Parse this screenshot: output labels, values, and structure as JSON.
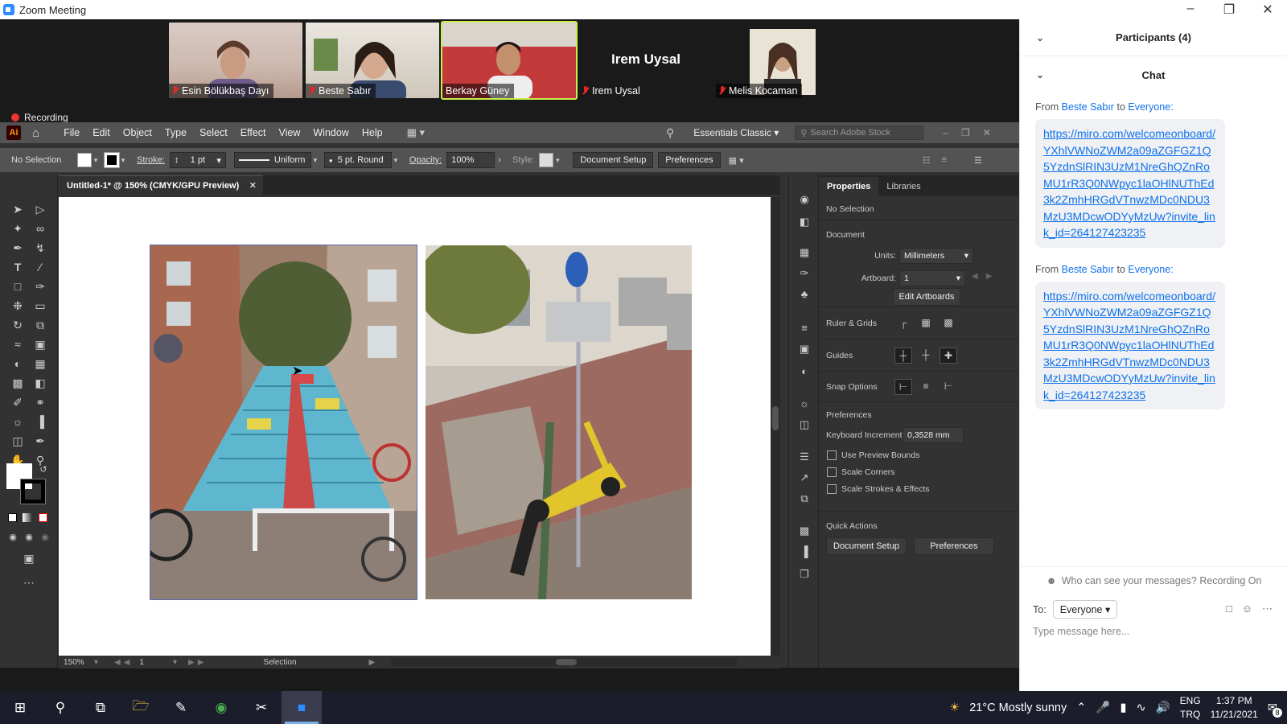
{
  "window": {
    "title": "Zoom Meeting"
  },
  "participants": [
    {
      "name": "Esin Bölükbaş Dayı",
      "muted": true
    },
    {
      "name": "Beste Sabır",
      "muted": true
    },
    {
      "name": "Berkay Güney",
      "muted": false
    },
    {
      "name": "Irem Uysal",
      "muted": true,
      "center_name": "Irem Uysal"
    },
    {
      "name": "Melis Kocaman",
      "muted": true
    }
  ],
  "recording_label": "Recording",
  "illustrator": {
    "menu": [
      "File",
      "Edit",
      "Object",
      "Type",
      "Select",
      "Effect",
      "View",
      "Window",
      "Help"
    ],
    "workspace": "Essentials Classic",
    "search_placeholder": "Search Adobe Stock",
    "control": {
      "selection": "No Selection",
      "stroke_label": "Stroke:",
      "stroke_value": "1 pt",
      "stroke_profile": "Uniform",
      "brush": "5 pt. Round",
      "opacity_label": "Opacity:",
      "opacity_value": "100%",
      "style_label": "Style:",
      "document_setup": "Document Setup",
      "preferences": "Preferences"
    },
    "doc_tab": "Untitled-1* @ 150% (CMYK/GPU Preview)",
    "status": {
      "zoom": "150%",
      "artboard": "1",
      "tool": "Selection"
    },
    "properties": {
      "tab_properties": "Properties",
      "tab_libraries": "Libraries",
      "no_selection": "No Selection",
      "document": "Document",
      "units_label": "Units:",
      "units_value": "Millimeters",
      "artboard_label": "Artboard:",
      "artboard_value": "1",
      "edit_artboards": "Edit Artboards",
      "ruler_grids": "Ruler & Grids",
      "guides": "Guides",
      "snap_options": "Snap Options",
      "preferences": "Preferences",
      "keyboard_increment_label": "Keyboard Increment:",
      "keyboard_increment_value": "0,3528 mm",
      "use_preview_bounds": "Use Preview Bounds",
      "scale_corners": "Scale Corners",
      "scale_strokes": "Scale Strokes & Effects",
      "quick_actions": "Quick Actions",
      "qa_document_setup": "Document Setup",
      "qa_preferences": "Preferences"
    }
  },
  "chat": {
    "participants_header": "Participants (4)",
    "chat_header": "Chat",
    "messages": [
      {
        "from_prefix": "From",
        "sender": "Beste Sabır",
        "to_word": "to",
        "recipient": "Everyone:",
        "text": "https://miro.com/welcomeonboard/YXhlVWNoZWM2a09aZGFGZ1Q5YzdnSlRIN3UzM1NreGhQZnRoMU1rR3Q0NWpyc1laOHlNUThEd3k2ZmhHRGdVTnwzMDc0NDU3MzU3MDcwODYyMzUw?invite_link_id=264127423235"
      },
      {
        "from_prefix": "From",
        "sender": "Beste Sabır",
        "to_word": "to",
        "recipient": "Everyone:",
        "text": "https://miro.com/welcomeonboard/YXhlVWNoZWM2a09aZGFGZ1Q5YzdnSlRIN3UzM1NreGhQZnRoMU1rR3Q0NWpyc1laOHlNUThEd3k2ZmhHRGdVTnwzMDc0NDU3MzU3MDcwODYyMzUw?invite_link_id=264127423235"
      }
    ],
    "visibility_note": "Who can see your messages? Recording On",
    "to_label": "To:",
    "to_value": "Everyone",
    "input_placeholder": "Type message here..."
  },
  "taskbar": {
    "weather": "21°C  Mostly sunny",
    "lang1": "ENG",
    "lang2": "TRQ",
    "time": "1:37 PM",
    "date": "11/21/2021",
    "notif_count": "8"
  }
}
